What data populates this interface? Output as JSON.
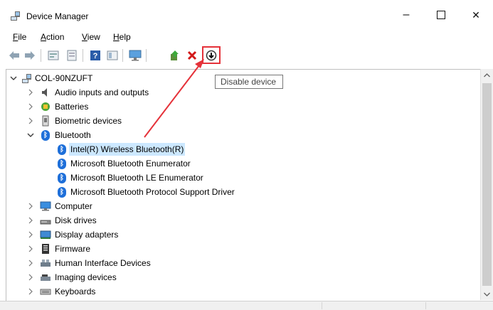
{
  "window": {
    "title": "Device Manager",
    "controls": {
      "minimize": "–",
      "close": "✕"
    }
  },
  "menu": [
    {
      "label": "File"
    },
    {
      "label": "Action"
    },
    {
      "label": "View"
    },
    {
      "label": "Help"
    }
  ],
  "toolbar": {
    "tooltip": "Disable device",
    "buttons": [
      "back-icon",
      "forward-icon",
      "properties-icon",
      "scan-icon",
      "help-icon",
      "view-icon",
      "monitor-icon",
      "update-driver-icon",
      "uninstall-icon",
      "disable-device-icon"
    ],
    "highlight_color": "#e5323a"
  },
  "tree": {
    "root": "COL-90NZUFT",
    "categories": [
      {
        "label": "Audio inputs and outputs",
        "icon": "speaker-icon",
        "expanded": false
      },
      {
        "label": "Batteries",
        "icon": "battery-icon",
        "expanded": false
      },
      {
        "label": "Biometric devices",
        "icon": "biometric-icon",
        "expanded": false
      },
      {
        "label": "Bluetooth",
        "icon": "bluetooth-icon",
        "expanded": true,
        "children": [
          {
            "label": "Intel(R) Wireless Bluetooth(R)",
            "selected": true
          },
          {
            "label": "Microsoft Bluetooth Enumerator"
          },
          {
            "label": "Microsoft Bluetooth LE Enumerator"
          },
          {
            "label": "Microsoft Bluetooth Protocol Support Driver"
          }
        ]
      },
      {
        "label": "Computer",
        "icon": "computer-icon",
        "expanded": false
      },
      {
        "label": "Disk drives",
        "icon": "disk-icon",
        "expanded": false
      },
      {
        "label": "Display adapters",
        "icon": "display-icon",
        "expanded": false
      },
      {
        "label": "Firmware",
        "icon": "firmware-icon",
        "expanded": false
      },
      {
        "label": "Human Interface Devices",
        "icon": "hid-icon",
        "expanded": false
      },
      {
        "label": "Imaging devices",
        "icon": "camera-icon",
        "expanded": false
      },
      {
        "label": "Keyboards",
        "icon": "keyboard-icon",
        "expanded": false
      }
    ]
  },
  "colors": {
    "selection": "#cce8ff",
    "bluetooth": "#1e6fd9"
  }
}
